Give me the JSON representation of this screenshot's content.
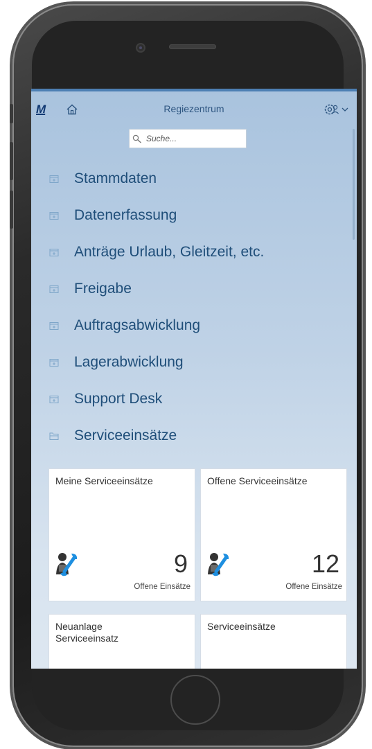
{
  "app": {
    "title": "Regiezentrum",
    "logo_text": "M"
  },
  "search": {
    "placeholder": "Suche..."
  },
  "menu": [
    {
      "label": "Stammdaten",
      "expanded": false
    },
    {
      "label": "Datenerfassung",
      "expanded": false
    },
    {
      "label": "Anträge Urlaub, Gleitzeit, etc.",
      "expanded": false
    },
    {
      "label": "Freigabe",
      "expanded": false
    },
    {
      "label": "Auftragsabwicklung",
      "expanded": false
    },
    {
      "label": "Lagerabwicklung",
      "expanded": false
    },
    {
      "label": "Support Desk",
      "expanded": false
    },
    {
      "label": "Serviceeinsätze",
      "expanded": true
    }
  ],
  "tiles": [
    {
      "title": "Meine Serviceeinsätze",
      "number": "9",
      "subtitle": "Offene Einsätze",
      "icon": "service-technician-icon"
    },
    {
      "title": "Offene Serviceeinsätze",
      "number": "12",
      "subtitle": "Offene Einsätze",
      "icon": "service-technician-icon"
    },
    {
      "title": "Neuanlage Serviceeinsatz",
      "number": "",
      "subtitle": "",
      "icon": ""
    },
    {
      "title": "Serviceeinsätze",
      "number": "",
      "subtitle": "",
      "icon": ""
    }
  ],
  "colors": {
    "accent": "#4d7fb3",
    "menu_text": "#1f4e79",
    "background_top": "#a9c3de",
    "background_bottom": "#dde7f1"
  }
}
